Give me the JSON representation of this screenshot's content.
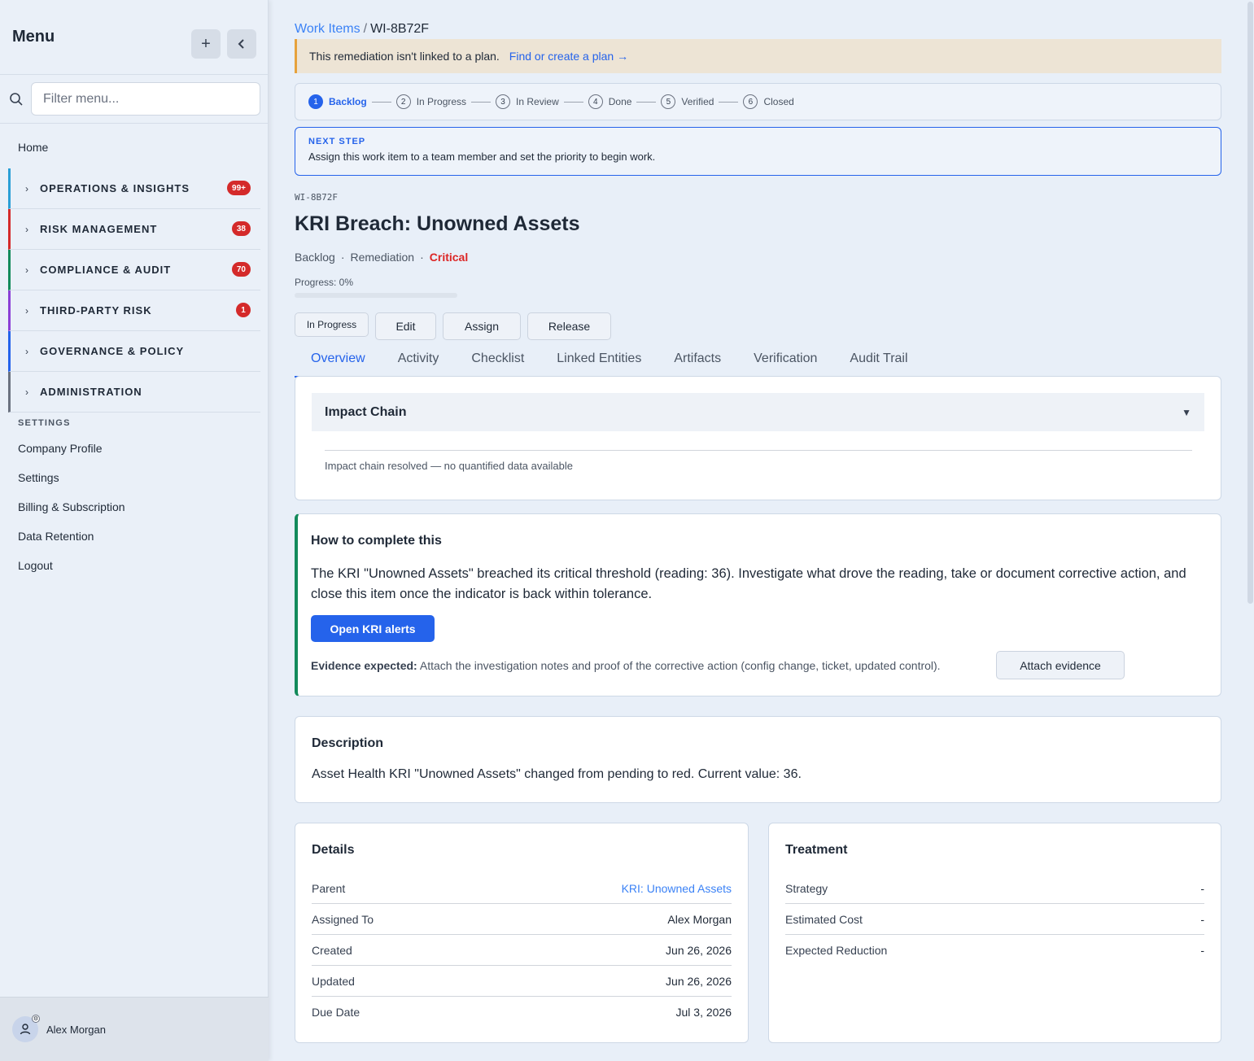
{
  "sidebar": {
    "title": "Menu",
    "search_placeholder": "Filter menu...",
    "home": "Home",
    "groups": [
      {
        "label": "OPERATIONS & INSIGHTS",
        "badge": "99+",
        "color": "#2a9fd6"
      },
      {
        "label": "RISK MANAGEMENT",
        "badge": "38",
        "color": "#d42a2a"
      },
      {
        "label": "COMPLIANCE & AUDIT",
        "badge": "70",
        "color": "#138a5b"
      },
      {
        "label": "THIRD-PARTY RISK",
        "badge": "1",
        "color": "#8b3fd6"
      },
      {
        "label": "GOVERNANCE & POLICY",
        "badge": "",
        "color": "#2563eb"
      },
      {
        "label": "ADMINISTRATION",
        "badge": "",
        "color": "#6b7280"
      }
    ],
    "settings_heading": "SETTINGS",
    "settings_items": [
      "Company Profile",
      "Settings",
      "Billing & Subscription",
      "Data Retention",
      "Logout"
    ],
    "user_name": "Alex Morgan"
  },
  "breadcrumb": {
    "parent": "Work Items",
    "separator": "/",
    "current": "WI-8B72F"
  },
  "banner": {
    "text": "This remediation isn't linked to a plan.",
    "link": "Find or create a plan →"
  },
  "stepper": [
    {
      "num": "1",
      "label": "Backlog",
      "active": true
    },
    {
      "num": "2",
      "label": "In Progress",
      "active": false
    },
    {
      "num": "3",
      "label": "In Review",
      "active": false
    },
    {
      "num": "4",
      "label": "Done",
      "active": false
    },
    {
      "num": "5",
      "label": "Verified",
      "active": false
    },
    {
      "num": "6",
      "label": "Closed",
      "active": false
    }
  ],
  "next_step": {
    "label": "NEXT STEP",
    "text": "Assign this work item to a team member and set the priority to begin work."
  },
  "item": {
    "id": "WI-8B72F",
    "title": "KRI Breach: Unowned Assets",
    "status": "Backlog",
    "type": "Remediation",
    "severity": "Critical",
    "progress_label": "Progress: 0%",
    "progress": 0
  },
  "actions": {
    "status_button": "In Progress",
    "edit": "Edit",
    "assign": "Assign",
    "release": "Release"
  },
  "tabs": [
    "Overview",
    "Activity",
    "Checklist",
    "Linked Entities",
    "Artifacts",
    "Verification",
    "Audit Trail"
  ],
  "impact": {
    "title": "Impact Chain",
    "text": "Impact chain resolved — no quantified data available"
  },
  "howto": {
    "title": "How to complete this",
    "text": "The KRI \"Unowned Assets\" breached its critical threshold (reading: 36). Investigate what drove the reading, take or document corrective action, and close this item once the indicator is back within tolerance.",
    "primary_button": "Open KRI alerts",
    "evidence_label": "Evidence expected:",
    "evidence_text": "Attach the investigation notes and proof of the corrective action (config change, ticket, updated control).",
    "attach_button": "Attach evidence"
  },
  "description": {
    "title": "Description",
    "text": "Asset Health KRI \"Unowned Assets\" changed from pending to red. Current value: 36."
  },
  "details": {
    "title": "Details",
    "rows": [
      {
        "label": "Parent",
        "value": "KRI: Unowned Assets"
      },
      {
        "label": "Assigned To",
        "value": "Alex Morgan"
      },
      {
        "label": "Created",
        "value": "Jun 26, 2026"
      },
      {
        "label": "Updated",
        "value": "Jun 26, 2026"
      },
      {
        "label": "Due Date",
        "value": "Jul 3, 2026"
      }
    ]
  },
  "treatment": {
    "title": "Treatment",
    "rows": [
      {
        "label": "Strategy",
        "value": "-"
      },
      {
        "label": "Estimated Cost",
        "value": "-"
      },
      {
        "label": "Expected Reduction",
        "value": "-"
      }
    ]
  }
}
